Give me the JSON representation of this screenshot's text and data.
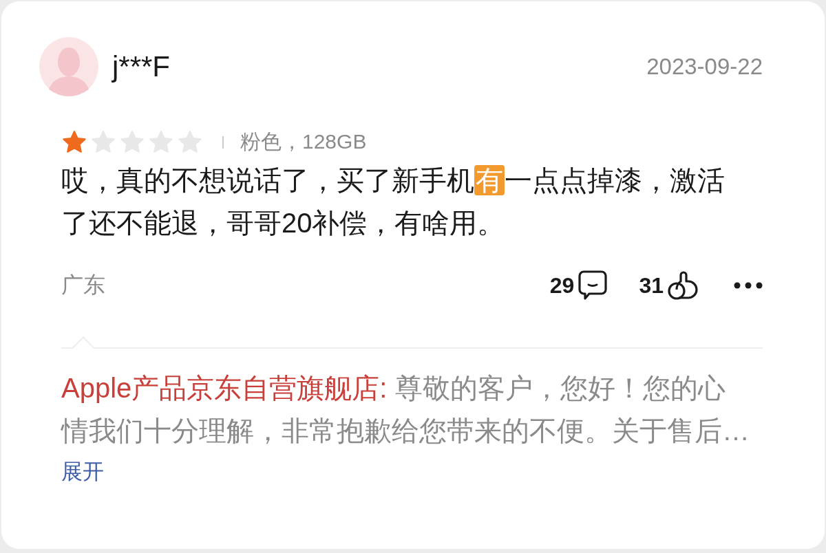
{
  "review": {
    "user": "j***F",
    "date": "2023-09-22",
    "stars": 1,
    "variant": "粉色，128GB",
    "content": [
      {
        "text": "哎，真的不想说话了，买了新手机",
        "highlighted": false
      },
      {
        "text": "有",
        "highlighted": true
      },
      {
        "text": "一点点掉漆，激活了还不能退，哥哥20补偿，有啥用。",
        "highlighted": false
      }
    ],
    "location": "广东",
    "comments": "29",
    "likes": "31",
    "reply": {
      "shop": "Apple产品京东自营旗舰店:",
      "text": "尊敬的客户，您好！您的心情我们十分理解，非常抱歉给您带来的不便。关于售后…",
      "expand": "展开"
    }
  }
}
